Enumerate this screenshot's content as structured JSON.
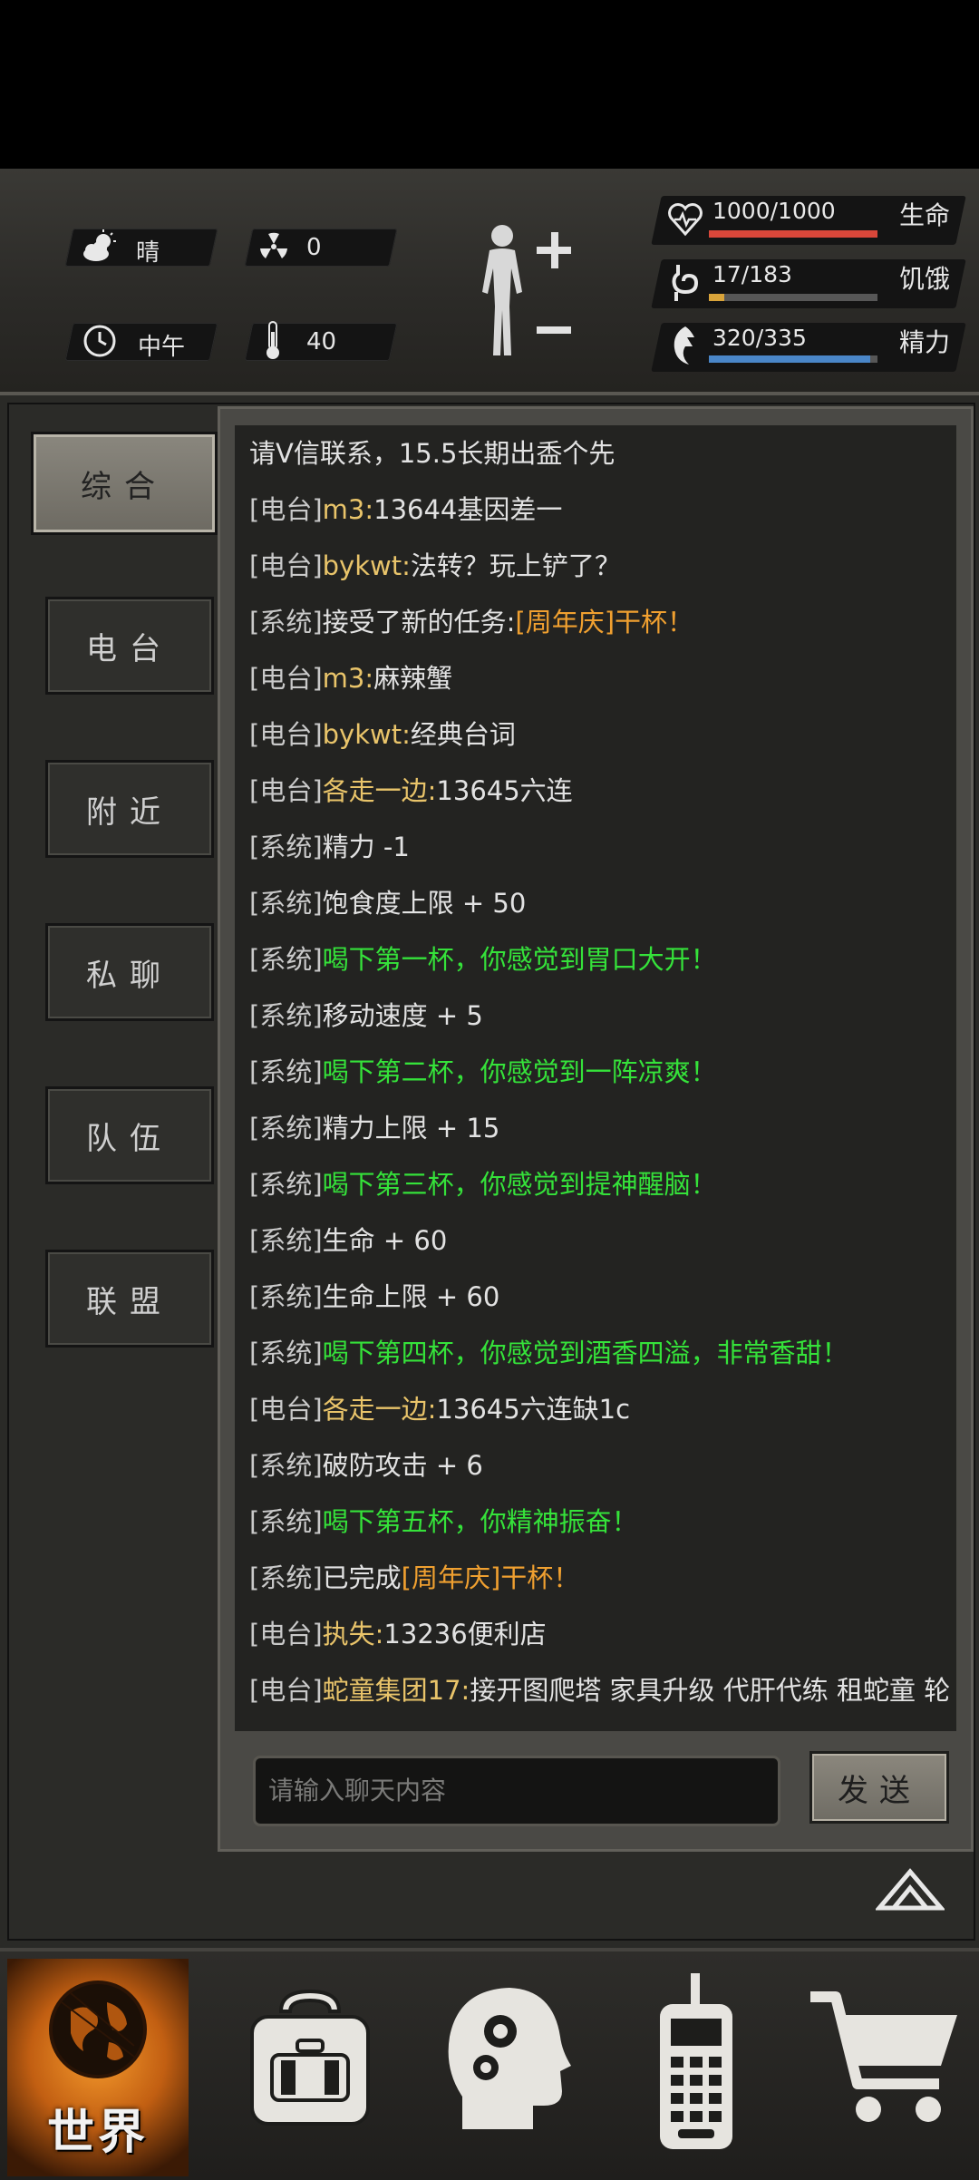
{
  "status": {
    "weather": "晴",
    "radiation": "0",
    "time_of_day": "中午",
    "temperature": "40",
    "bars": [
      {
        "value_text": "1000/1000",
        "label": "生命",
        "fraction": 1.0,
        "color": "#d9473a"
      },
      {
        "value_text": "17/183",
        "label": "饥饿",
        "fraction": 0.093,
        "color": "#d9a43a"
      },
      {
        "value_text": "320/335",
        "label": "精力",
        "fraction": 0.955,
        "color": "#4a86c8"
      }
    ]
  },
  "tabs": [
    "综合",
    "电台",
    "附近",
    "私聊",
    "队伍",
    "联盟"
  ],
  "chat": {
    "lines": [
      {
        "tag": "",
        "name": "",
        "text": "请V信联系，15.5长期出盉个先",
        "style": "white"
      },
      {
        "tag": "[电台]",
        "name": "m3:",
        "text": "13644基因差一",
        "style": "white"
      },
      {
        "tag": "[电台]",
        "name": "bykwt:",
        "text": "法转？玩上铲了？",
        "style": "white"
      },
      {
        "tag": "[系统]",
        "name": "",
        "text": "接受了新的任务:",
        "highlight": "[周年庆]干杯！",
        "style": "white"
      },
      {
        "tag": "[电台]",
        "name": "m3:",
        "text": "麻辣蟹",
        "style": "white"
      },
      {
        "tag": "[电台]",
        "name": "bykwt:",
        "text": "经典台词",
        "style": "white"
      },
      {
        "tag": "[电台]",
        "name": "各走一边:",
        "text": "13645六连",
        "style": "white"
      },
      {
        "tag": "[系统]",
        "name": "",
        "text": "精力 -1",
        "style": "white"
      },
      {
        "tag": "[系统]",
        "name": "",
        "text": "饱食度上限 + 50",
        "style": "white"
      },
      {
        "tag": "[系统]",
        "name": "",
        "text": "喝下第一杯，你感觉到胃口大开！",
        "style": "green"
      },
      {
        "tag": "[系统]",
        "name": "",
        "text": "移动速度 + 5",
        "style": "white"
      },
      {
        "tag": "[系统]",
        "name": "",
        "text": "喝下第二杯，你感觉到一阵凉爽！",
        "style": "green"
      },
      {
        "tag": "[系统]",
        "name": "",
        "text": "精力上限 + 15",
        "style": "white"
      },
      {
        "tag": "[系统]",
        "name": "",
        "text": "喝下第三杯，你感觉到提神醒脑！",
        "style": "green"
      },
      {
        "tag": "[系统]",
        "name": "",
        "text": "生命 + 60",
        "style": "white"
      },
      {
        "tag": "[系统]",
        "name": "",
        "text": "生命上限 + 60",
        "style": "white"
      },
      {
        "tag": "[系统]",
        "name": "",
        "text": "喝下第四杯，你感觉到酒香四溢，非常香甜！",
        "style": "green"
      },
      {
        "tag": "[电台]",
        "name": "各走一边:",
        "text": "13645六连缺1c",
        "style": "white"
      },
      {
        "tag": "[系统]",
        "name": "",
        "text": "破防攻击 + 6",
        "style": "white"
      },
      {
        "tag": "[系统]",
        "name": "",
        "text": "喝下第五杯，你精神振奋！",
        "style": "green"
      },
      {
        "tag": "[系统]",
        "name": "",
        "text": "已完成",
        "highlight": "[周年庆]干杯！",
        "style": "white"
      },
      {
        "tag": "[电台]",
        "name": "执失:",
        "text": "13236便利店",
        "style": "white"
      },
      {
        "tag": "[电台]",
        "name": "蛇童集团17:",
        "text": "接开图爬塔 家具升级 代肝代练 租蛇童 轮",
        "style": "white"
      }
    ],
    "input_placeholder": "请输入聊天内容",
    "send_label": "发送"
  },
  "bottom_nav": {
    "world_label": "世界",
    "items": [
      "backpack-icon",
      "skills-head-icon",
      "radio-icon",
      "shop-cart-icon"
    ]
  }
}
